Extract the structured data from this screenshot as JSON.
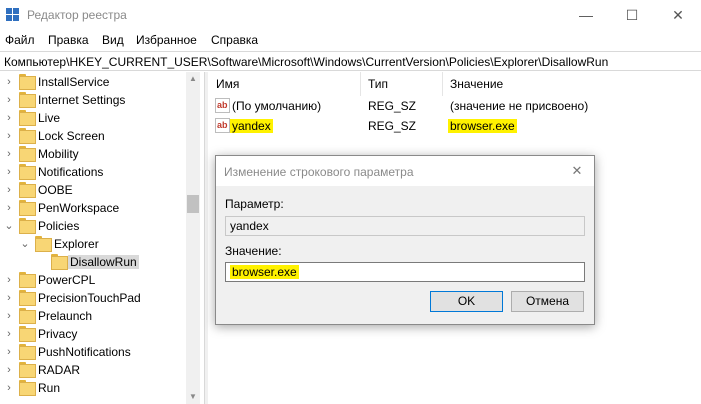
{
  "window": {
    "title": "Редактор реестра",
    "minimize_glyph": "—",
    "maximize_glyph": "☐",
    "close_glyph": "✕"
  },
  "menu": {
    "file": "Файл",
    "edit": "Правка",
    "view": "Вид",
    "favorites": "Избранное",
    "help": "Справка"
  },
  "address": "Компьютер\\HKEY_CURRENT_USER\\Software\\Microsoft\\Windows\\CurrentVersion\\Policies\\Explorer\\DisallowRun",
  "tree": {
    "items": [
      {
        "label": "InstallService",
        "expand": "›"
      },
      {
        "label": "Internet Settings",
        "expand": "›"
      },
      {
        "label": "Live",
        "expand": "›"
      },
      {
        "label": "Lock Screen",
        "expand": "›"
      },
      {
        "label": "Mobility",
        "expand": "›"
      },
      {
        "label": "Notifications",
        "expand": "›"
      },
      {
        "label": "OOBE",
        "expand": "›"
      },
      {
        "label": "PenWorkspace",
        "expand": "›"
      },
      {
        "label": "Policies",
        "expand": "⌄"
      },
      {
        "label": "Explorer",
        "expand": "⌄"
      },
      {
        "label": "DisallowRun",
        "expand": ""
      },
      {
        "label": "PowerCPL",
        "expand": "›"
      },
      {
        "label": "PrecisionTouchPad",
        "expand": "›"
      },
      {
        "label": "Prelaunch",
        "expand": "›"
      },
      {
        "label": "Privacy",
        "expand": "›"
      },
      {
        "label": "PushNotifications",
        "expand": "›"
      },
      {
        "label": "RADAR",
        "expand": "›"
      },
      {
        "label": "Run",
        "expand": "›"
      }
    ]
  },
  "list": {
    "headers": {
      "name": "Имя",
      "type": "Тип",
      "value": "Значение"
    },
    "rows": [
      {
        "icon": "ab",
        "name": "(По умолчанию)",
        "type": "REG_SZ",
        "value": "(значение не присвоено)"
      },
      {
        "icon": "ab",
        "name": "yandex",
        "type": "REG_SZ",
        "value": "browser.exe"
      }
    ]
  },
  "dialog": {
    "title": "Изменение строкового параметра",
    "close_glyph": "✕",
    "param_label": "Параметр:",
    "param_value": "yandex",
    "value_label": "Значение:",
    "value_value": "browser.exe",
    "ok": "OK",
    "cancel": "Отмена"
  },
  "colors": {
    "highlight": "#fff200",
    "folder": "#f8d675",
    "accent": "#0078d7"
  }
}
